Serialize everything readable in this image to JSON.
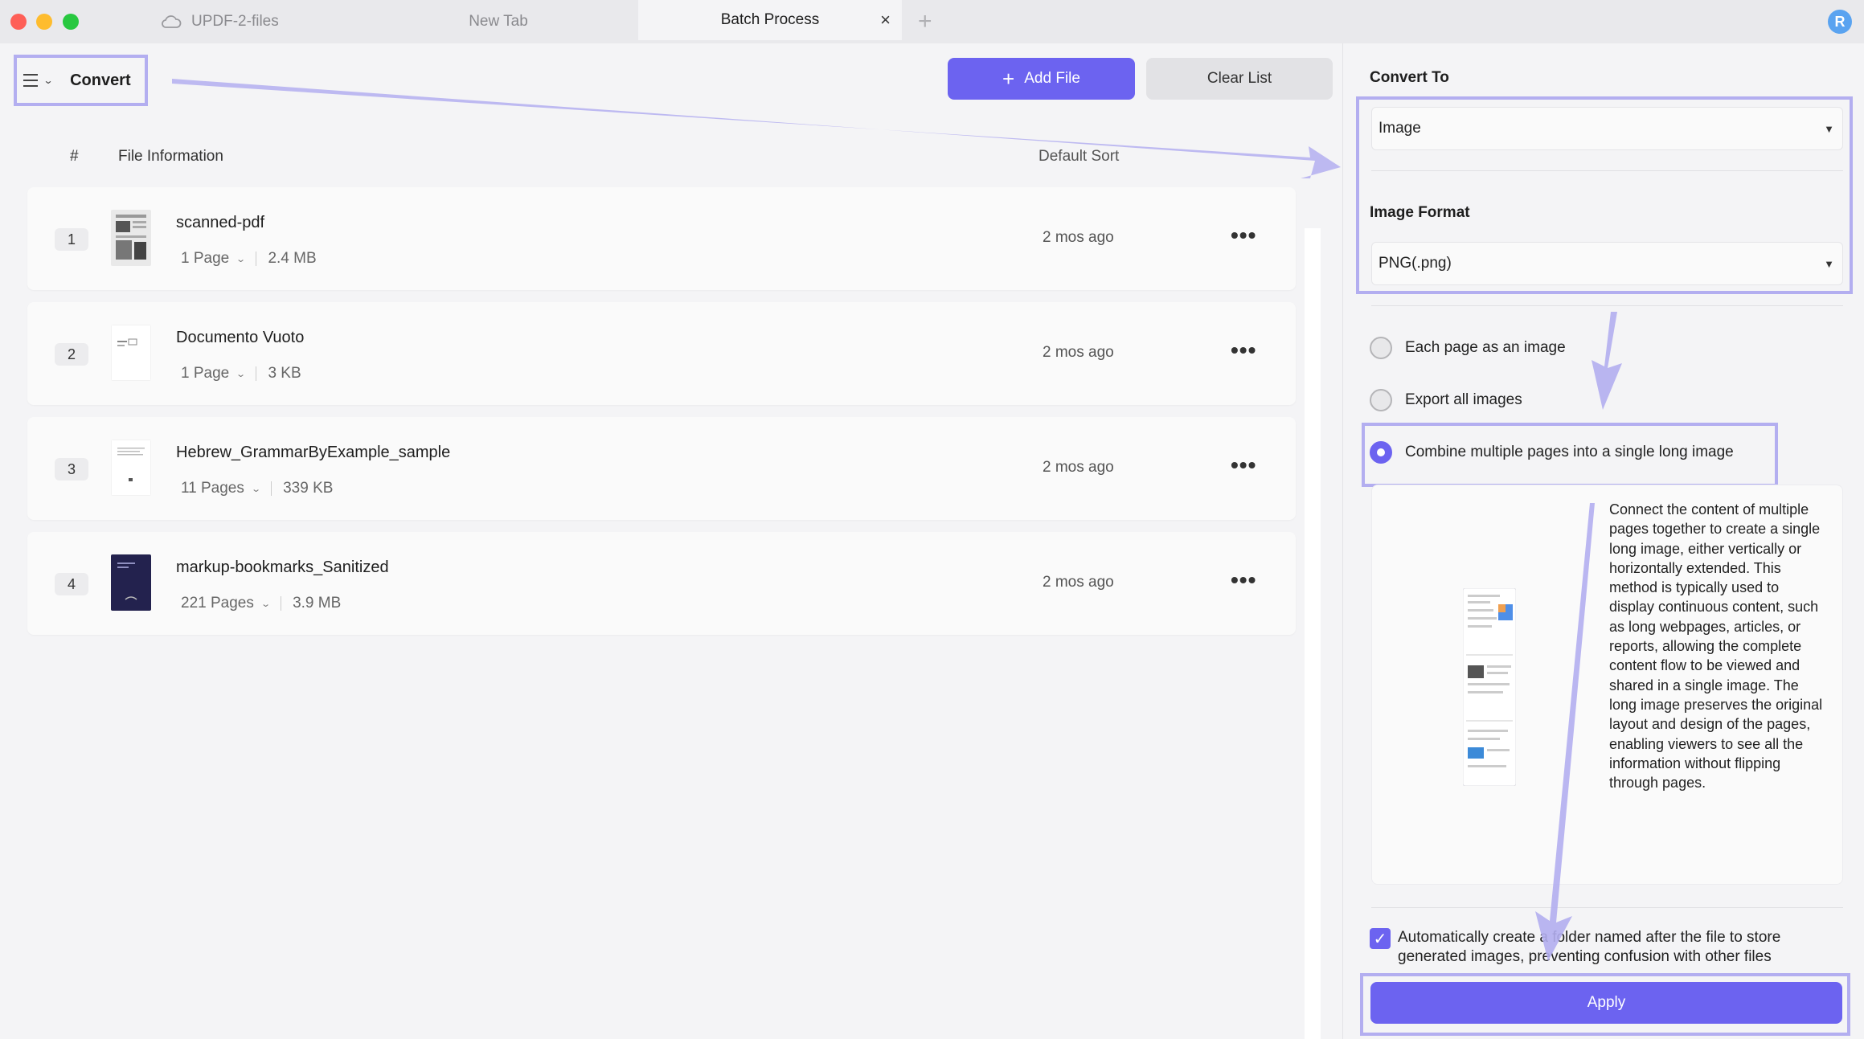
{
  "tabs": [
    {
      "label": "UPDF-2-files",
      "icon": "cloud-icon"
    },
    {
      "label": "New Tab"
    },
    {
      "label": "Batch Process",
      "close": "×"
    }
  ],
  "new_tab_symbol": "+",
  "avatar_initial": "R",
  "toolbar": {
    "menu_label": "Convert",
    "add_file_label": "Add File",
    "clear_list_label": "Clear List"
  },
  "table": {
    "columns": {
      "num": "#",
      "info": "File Information",
      "sort": "Default Sort"
    },
    "rows": [
      {
        "num": "1",
        "name": "scanned-pdf",
        "pages": "1 Page",
        "size": "2.4 MB",
        "time": "2 mos ago"
      },
      {
        "num": "2",
        "name": "Documento Vuoto",
        "pages": "1 Page",
        "size": "3 KB",
        "time": "2 mos ago"
      },
      {
        "num": "3",
        "name": "Hebrew_GrammarByExample_sample",
        "pages": "11 Pages",
        "size": "339 KB",
        "time": "2 mos ago"
      },
      {
        "num": "4",
        "name": "markup-bookmarks_Sanitized",
        "pages": "221 Pages",
        "size": "3.9 MB",
        "time": "2 mos ago"
      }
    ],
    "more_symbol": "•••"
  },
  "panel": {
    "convert_to_label": "Convert To",
    "convert_to_value": "Image",
    "image_format_label": "Image Format",
    "image_format_value": "PNG(.png)",
    "options": [
      {
        "label": "Each page as an image",
        "selected": false
      },
      {
        "label": "Export all images",
        "selected": false
      },
      {
        "label": "Combine multiple pages into a single long image",
        "selected": true
      }
    ],
    "description": "Connect the content of multiple pages together to create a single long image, either vertically or horizontally extended. This method is typically used to display continuous content, such as long webpages, articles, or reports, allowing the complete content flow to be viewed and shared in a single image. The long image preserves the original layout and design of the pages, enabling viewers to see all the information without flipping through pages.",
    "auto_folder_text": "Automatically create a folder named after the file to store generated images, preventing confusion with other files",
    "auto_folder_checked": true,
    "apply_label": "Apply"
  },
  "colors": {
    "accent": "#6c63f0",
    "highlight": "#b3aef0"
  }
}
